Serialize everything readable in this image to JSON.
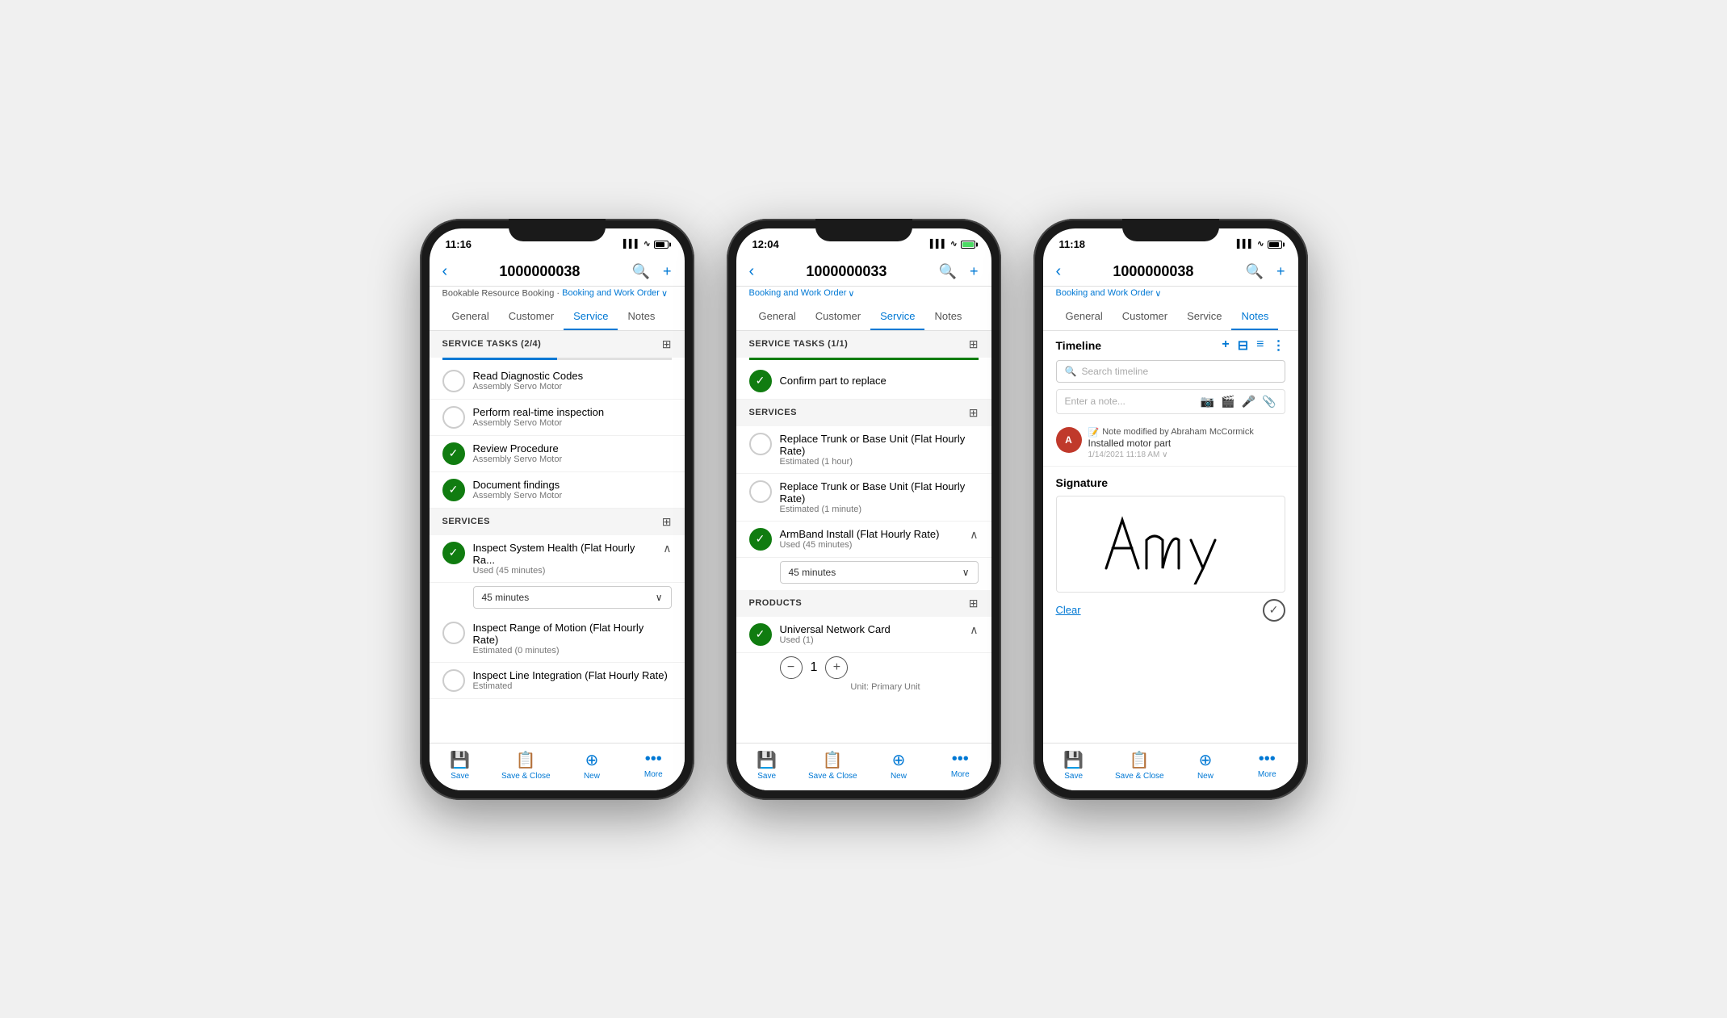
{
  "phone1": {
    "time": "11:16",
    "title": "1000000038",
    "subtitle1": "Bookable Resource Booking",
    "subtitle2": "Booking and Work Order",
    "tabs": [
      "General",
      "Customer",
      "Service",
      "Notes"
    ],
    "activeTab": "Service",
    "serviceTasks": {
      "label": "SERVICE TASKS (2/4)",
      "progress": 50,
      "items": [
        {
          "name": "Read Diagnostic Codes",
          "sub": "Assembly Servo Motor",
          "done": false
        },
        {
          "name": "Perform real-time inspection",
          "sub": "Assembly Servo Motor",
          "done": false
        },
        {
          "name": "Review Procedure",
          "sub": "Assembly Servo Motor",
          "done": true
        },
        {
          "name": "Document findings",
          "sub": "Assembly Servo Motor",
          "done": true
        }
      ]
    },
    "services": {
      "label": "SERVICES",
      "items": [
        {
          "name": "Inspect System Health (Flat Hourly Ra...",
          "sub": "Used (45 minutes)",
          "done": true,
          "expanded": true,
          "duration": "45 minutes"
        },
        {
          "name": "Inspect Range of Motion (Flat Hourly Rate)",
          "sub": "Estimated (0 minutes)",
          "done": false
        },
        {
          "name": "Inspect Line Integration (Flat Hourly Rate)",
          "sub": "Estimated",
          "done": false
        }
      ]
    },
    "bottomBar": [
      "Save",
      "Save & Close",
      "New",
      "More"
    ]
  },
  "phone2": {
    "time": "12:04",
    "title": "1000000033",
    "subtitle2": "Booking and Work Order",
    "tabs": [
      "General",
      "Customer",
      "Service",
      "Notes"
    ],
    "activeTab": "Service",
    "serviceTasks": {
      "label": "SERVICE TASKS (1/1)",
      "progress": 100,
      "items": [
        {
          "name": "Confirm part to replace",
          "sub": "",
          "done": true
        }
      ]
    },
    "services": {
      "label": "SERVICES",
      "items": [
        {
          "name": "Replace Trunk or Base Unit (Flat Hourly Rate)",
          "sub": "Estimated (1 hour)",
          "done": false
        },
        {
          "name": "Replace Trunk or Base Unit (Flat Hourly Rate)",
          "sub": "Estimated (1 minute)",
          "done": false
        },
        {
          "name": "ArmBand Install (Flat Hourly Rate)",
          "sub": "Used (45 minutes)",
          "done": true,
          "expanded": true,
          "duration": "45 minutes"
        }
      ]
    },
    "products": {
      "label": "PRODUCTS",
      "items": [
        {
          "name": "Universal Network Card",
          "sub": "Used (1)",
          "done": true,
          "expanded": true,
          "qty": 1,
          "unit": "Unit: Primary Unit"
        }
      ]
    },
    "bottomBar": [
      "Save",
      "Save & Close",
      "New",
      "More"
    ]
  },
  "phone3": {
    "time": "11:18",
    "title": "1000000038",
    "subtitle2": "Booking and Work Order",
    "tabs": [
      "General",
      "Customer",
      "Service",
      "Notes"
    ],
    "activeTab": "Notes",
    "timeline": {
      "label": "Timeline",
      "searchPlaceholder": "Search timeline",
      "notePlaceholder": "Enter a note...",
      "noteEntry": {
        "author": "Note modified by Abraham McCormick",
        "text": "Installed motor part",
        "time": "1/14/2021 11:18 AM"
      }
    },
    "signature": {
      "label": "Signature",
      "clearLabel": "Clear"
    },
    "bottomBar": [
      "Save",
      "Save & Close",
      "New",
      "More"
    ]
  },
  "icons": {
    "back": "‹",
    "search": "🔍",
    "add": "+",
    "grid": "⊞",
    "check": "✓",
    "chevronDown": "∨",
    "chevronUp": "∧",
    "save": "💾",
    "saveClose": "📋",
    "new": "+",
    "more": "•••",
    "camera": "📷",
    "video": "📹",
    "mic": "🎤",
    "attach": "📎",
    "filter": "⊟",
    "list": "≡",
    "ellipsis": "⋮",
    "note": "📝",
    "minus": "−",
    "plus": "+"
  }
}
